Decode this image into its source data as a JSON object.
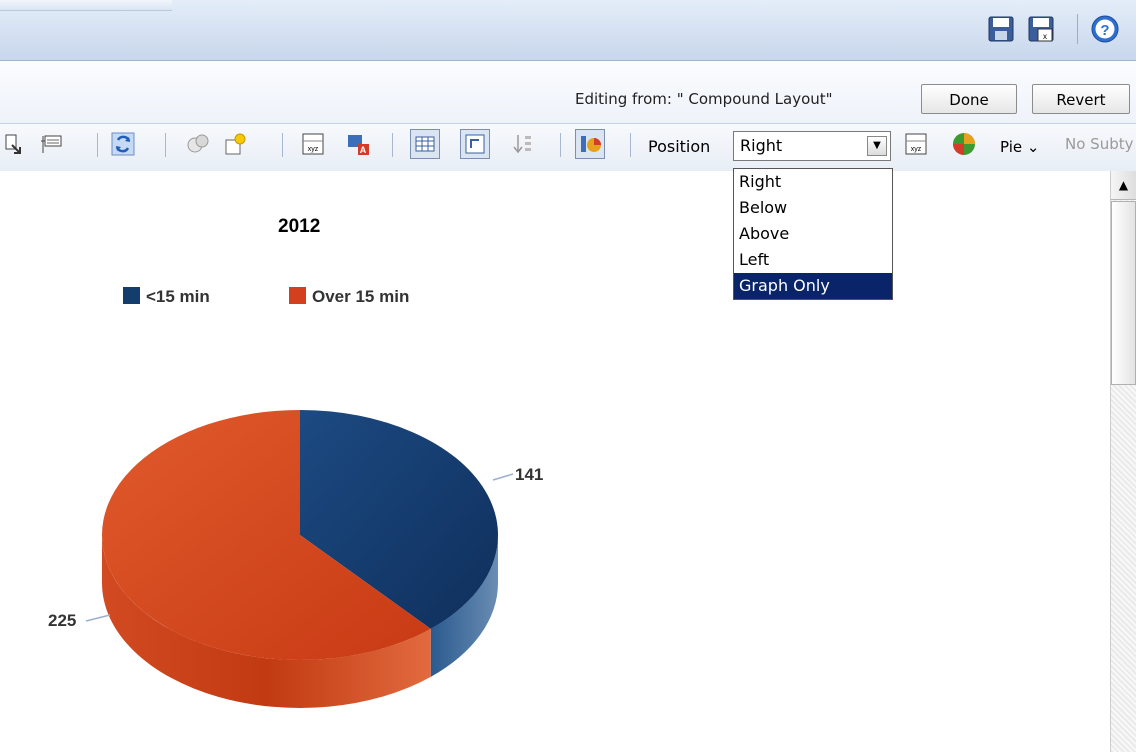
{
  "header": {
    "save_icon": "save-icon",
    "save_as_icon": "save-as-icon",
    "help_icon": "help-icon"
  },
  "editing": {
    "label": "Editing from: \" Compound Layout\"",
    "done_label": "Done",
    "revert_label": "Revert"
  },
  "toolbar": {
    "position_label": "Position",
    "position_value": "Right",
    "chart_type_label": "Pie",
    "subtitle_hint": "No Subty"
  },
  "position_options": [
    "Right",
    "Below",
    "Above",
    "Left",
    "Graph Only"
  ],
  "position_highlighted": "Graph Only",
  "colors": {
    "series_under": "#123d6d",
    "series_over": "#d2401d",
    "selection": "#0a246a"
  },
  "chart_data": {
    "type": "pie",
    "title": "2012",
    "legend_position": "top",
    "series": [
      {
        "name": "<15 min",
        "value": 141
      },
      {
        "name": "Over 15 min",
        "value": 225
      }
    ],
    "data_labels": [
      "141",
      "225"
    ]
  }
}
